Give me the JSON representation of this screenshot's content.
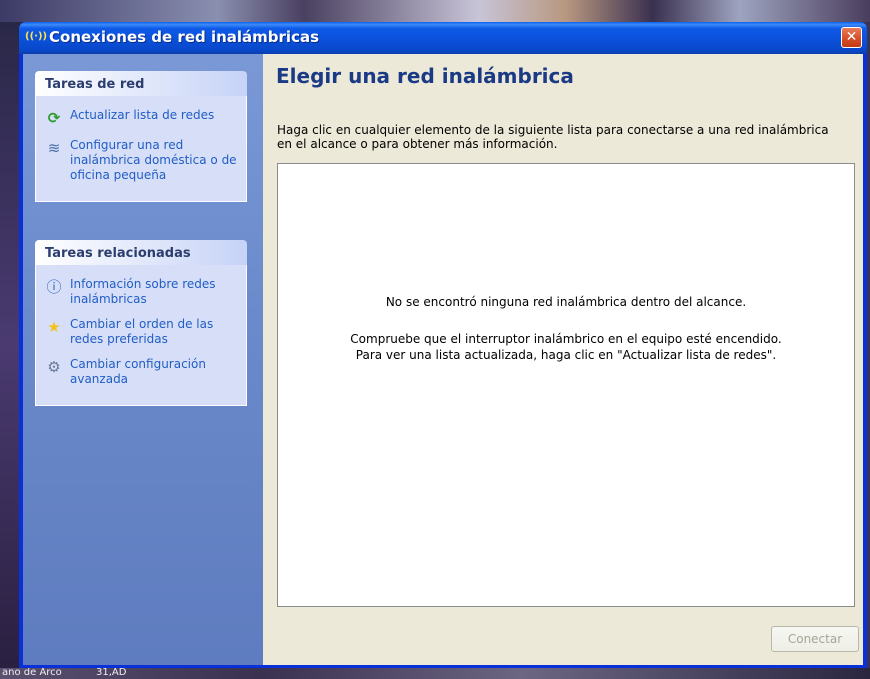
{
  "window": {
    "title": "Conexiones de red inalámbricas"
  },
  "taskpane": {
    "network_tasks": {
      "header": "Tareas de red",
      "items": [
        {
          "label": "Actualizar lista de redes",
          "icon": "refresh-icon"
        },
        {
          "label": "Configurar una red inalámbrica doméstica o de oficina pequeña",
          "icon": "wireless-setup-icon"
        }
      ]
    },
    "related_tasks": {
      "header": "Tareas relacionadas",
      "items": [
        {
          "label": "Información sobre redes inalámbricas",
          "icon": "info-icon"
        },
        {
          "label": "Cambiar el orden de las redes preferidas",
          "icon": "star-icon"
        },
        {
          "label": "Cambiar configuración avanzada",
          "icon": "tools-icon"
        }
      ]
    }
  },
  "main": {
    "title": "Elegir una red inalámbrica",
    "description": "Haga clic en cualquier elemento de la siguiente lista para conectarse a una red inalámbrica en el alcance o para obtener más información.",
    "empty_message": "No se encontró ninguna red inalámbrica dentro del alcance.",
    "hint_line1": "Compruebe que el interruptor inalámbrico en el equipo esté encendido.",
    "hint_line2": "Para ver una lista actualizada, haga clic en \"Actualizar lista de redes\".",
    "connect_label": "Conectar"
  },
  "desktop": {
    "bottom_labels": [
      "ano de Arco",
      "31,AD"
    ]
  },
  "colors": {
    "titlebar": "#0a4fd8",
    "link": "#215dc6",
    "heading": "#1a3a86",
    "close": "#d9522c"
  }
}
